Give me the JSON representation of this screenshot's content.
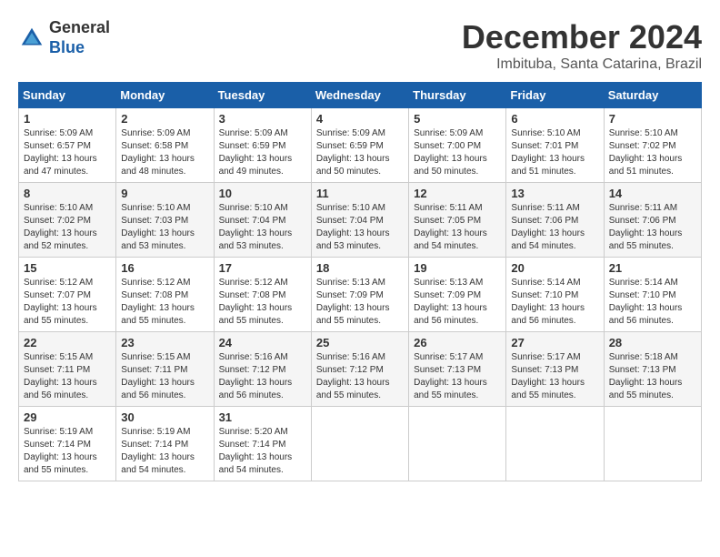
{
  "header": {
    "logo_line1": "General",
    "logo_line2": "Blue",
    "month": "December 2024",
    "location": "Imbituba, Santa Catarina, Brazil"
  },
  "weekdays": [
    "Sunday",
    "Monday",
    "Tuesday",
    "Wednesday",
    "Thursday",
    "Friday",
    "Saturday"
  ],
  "weeks": [
    [
      {
        "day": "1",
        "sunrise": "5:09 AM",
        "sunset": "6:57 PM",
        "daylight": "13 hours and 47 minutes."
      },
      {
        "day": "2",
        "sunrise": "5:09 AM",
        "sunset": "6:58 PM",
        "daylight": "13 hours and 48 minutes."
      },
      {
        "day": "3",
        "sunrise": "5:09 AM",
        "sunset": "6:59 PM",
        "daylight": "13 hours and 49 minutes."
      },
      {
        "day": "4",
        "sunrise": "5:09 AM",
        "sunset": "6:59 PM",
        "daylight": "13 hours and 50 minutes."
      },
      {
        "day": "5",
        "sunrise": "5:09 AM",
        "sunset": "7:00 PM",
        "daylight": "13 hours and 50 minutes."
      },
      {
        "day": "6",
        "sunrise": "5:10 AM",
        "sunset": "7:01 PM",
        "daylight": "13 hours and 51 minutes."
      },
      {
        "day": "7",
        "sunrise": "5:10 AM",
        "sunset": "7:02 PM",
        "daylight": "13 hours and 51 minutes."
      }
    ],
    [
      {
        "day": "8",
        "sunrise": "5:10 AM",
        "sunset": "7:02 PM",
        "daylight": "13 hours and 52 minutes."
      },
      {
        "day": "9",
        "sunrise": "5:10 AM",
        "sunset": "7:03 PM",
        "daylight": "13 hours and 53 minutes."
      },
      {
        "day": "10",
        "sunrise": "5:10 AM",
        "sunset": "7:04 PM",
        "daylight": "13 hours and 53 minutes."
      },
      {
        "day": "11",
        "sunrise": "5:10 AM",
        "sunset": "7:04 PM",
        "daylight": "13 hours and 53 minutes."
      },
      {
        "day": "12",
        "sunrise": "5:11 AM",
        "sunset": "7:05 PM",
        "daylight": "13 hours and 54 minutes."
      },
      {
        "day": "13",
        "sunrise": "5:11 AM",
        "sunset": "7:06 PM",
        "daylight": "13 hours and 54 minutes."
      },
      {
        "day": "14",
        "sunrise": "5:11 AM",
        "sunset": "7:06 PM",
        "daylight": "13 hours and 55 minutes."
      }
    ],
    [
      {
        "day": "15",
        "sunrise": "5:12 AM",
        "sunset": "7:07 PM",
        "daylight": "13 hours and 55 minutes."
      },
      {
        "day": "16",
        "sunrise": "5:12 AM",
        "sunset": "7:08 PM",
        "daylight": "13 hours and 55 minutes."
      },
      {
        "day": "17",
        "sunrise": "5:12 AM",
        "sunset": "7:08 PM",
        "daylight": "13 hours and 55 minutes."
      },
      {
        "day": "18",
        "sunrise": "5:13 AM",
        "sunset": "7:09 PM",
        "daylight": "13 hours and 55 minutes."
      },
      {
        "day": "19",
        "sunrise": "5:13 AM",
        "sunset": "7:09 PM",
        "daylight": "13 hours and 56 minutes."
      },
      {
        "day": "20",
        "sunrise": "5:14 AM",
        "sunset": "7:10 PM",
        "daylight": "13 hours and 56 minutes."
      },
      {
        "day": "21",
        "sunrise": "5:14 AM",
        "sunset": "7:10 PM",
        "daylight": "13 hours and 56 minutes."
      }
    ],
    [
      {
        "day": "22",
        "sunrise": "5:15 AM",
        "sunset": "7:11 PM",
        "daylight": "13 hours and 56 minutes."
      },
      {
        "day": "23",
        "sunrise": "5:15 AM",
        "sunset": "7:11 PM",
        "daylight": "13 hours and 56 minutes."
      },
      {
        "day": "24",
        "sunrise": "5:16 AM",
        "sunset": "7:12 PM",
        "daylight": "13 hours and 56 minutes."
      },
      {
        "day": "25",
        "sunrise": "5:16 AM",
        "sunset": "7:12 PM",
        "daylight": "13 hours and 55 minutes."
      },
      {
        "day": "26",
        "sunrise": "5:17 AM",
        "sunset": "7:13 PM",
        "daylight": "13 hours and 55 minutes."
      },
      {
        "day": "27",
        "sunrise": "5:17 AM",
        "sunset": "7:13 PM",
        "daylight": "13 hours and 55 minutes."
      },
      {
        "day": "28",
        "sunrise": "5:18 AM",
        "sunset": "7:13 PM",
        "daylight": "13 hours and 55 minutes."
      }
    ],
    [
      {
        "day": "29",
        "sunrise": "5:19 AM",
        "sunset": "7:14 PM",
        "daylight": "13 hours and 55 minutes."
      },
      {
        "day": "30",
        "sunrise": "5:19 AM",
        "sunset": "7:14 PM",
        "daylight": "13 hours and 54 minutes."
      },
      {
        "day": "31",
        "sunrise": "5:20 AM",
        "sunset": "7:14 PM",
        "daylight": "13 hours and 54 minutes."
      },
      null,
      null,
      null,
      null
    ]
  ]
}
